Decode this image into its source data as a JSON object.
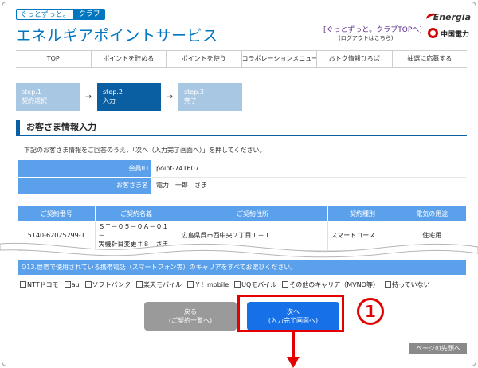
{
  "header": {
    "badge_left": "ぐっとずっと。",
    "badge_right": "クラブ",
    "site_title": "エネルギアポイントサービス",
    "top_link": "[ぐっとずっと。クラブTOPへ]",
    "top_link_sub": "(ログアウトはこちら)",
    "logo_word": "Energia",
    "logo_company": "中国電力"
  },
  "nav": [
    "TOP",
    "ポイントを貯める",
    "ポイントを使う",
    "コラボレーションメニュー",
    "おトク情報ひろば",
    "抽選に応募する"
  ],
  "steps": [
    {
      "num": "step.1",
      "label": "契約選択",
      "active": false
    },
    {
      "num": "step.2",
      "label": "入力",
      "active": true
    },
    {
      "num": "step.3",
      "label": "完了",
      "active": false
    }
  ],
  "step_arrow": "→",
  "section_title": "お客さま情報入力",
  "instruction": "下記のお客さま情報をご回答のうえ，「次へ（入力完了画面へ）」を押してください。",
  "member": {
    "id_label": "会員ID",
    "id_value": "point-741607",
    "name_label": "お客さま名",
    "name_value": "電力　一郎　さま"
  },
  "contract_table": {
    "headers": [
      "ご契約番号",
      "ご契約名義",
      "ご契約住所",
      "契約種別",
      "電気の用途"
    ],
    "row": {
      "number": "5140-62025299-1",
      "holder_line1": "ＳＴ－０５－０Ａ－０１－",
      "holder_line2": "実機針目変更＃８　さま",
      "address": "広島県呉市西中央２丁目１－１",
      "type": "スマートコース",
      "use": "住宅用"
    }
  },
  "question": {
    "text": "Q13.世帯で使用されている携帯電話（スマートフォン等）のキャリアをすべてお選びください。",
    "options": [
      "NTTドコモ",
      "au",
      "ソフトバンク",
      "楽天モバイル",
      "Ｙ！mobile",
      "UQモバイル",
      "その他のキャリア（MVNO等）",
      "持っていない"
    ]
  },
  "buttons": {
    "back_line1": "戻る",
    "back_line2": "(ご契約一覧へ)",
    "next_line1": "次へ",
    "next_line2": "(入力完了画面へ)"
  },
  "callout_number": "1",
  "page_top": "ページの先頭へ",
  "colors": {
    "brand_blue": "#0076c0",
    "table_header_blue": "#5ba0eb",
    "step_active": "#0a5fa3",
    "next_button": "#1670e8",
    "callout_red": "#e40000"
  }
}
